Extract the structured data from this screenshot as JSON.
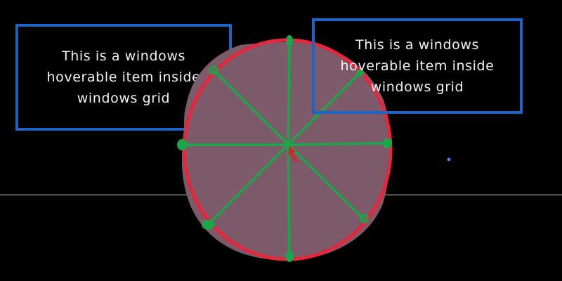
{
  "grid_items": [
    {
      "text": "This is a windows\nhoverable item inside\nwindows grid"
    },
    {
      "text": "This is a windows\nhoverable item inside\nwindows grid"
    }
  ],
  "colors": {
    "background": "#000000",
    "item_border": "#1f63c4",
    "item_text": "#f2f2f2",
    "circle_fill": "#7d5a6a",
    "circle_stroke": "#e3283d",
    "spokes": "#1aa64a",
    "cursor": "#e01f1f",
    "divider": "#cfcfcf",
    "dot": "#4a7bd6"
  },
  "icons": [
    "radial-menu-circle",
    "pointer-cursor-icon"
  ]
}
